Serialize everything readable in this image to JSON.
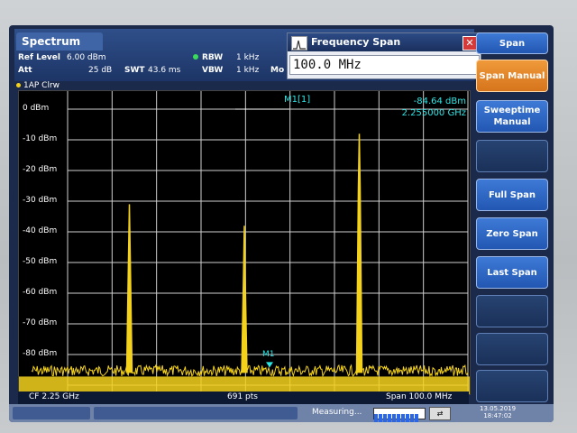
{
  "app": {
    "title": "Spectrum"
  },
  "header": {
    "ref_level_label": "Ref Level",
    "ref_level_value": "6.00 dBm",
    "att_label": "Att",
    "att_value": "25 dB",
    "swt_label": "SWT",
    "swt_value": "43.6 ms",
    "rbw_label": "RBW",
    "rbw_value": "1 kHz",
    "vbw_label": "VBW",
    "vbw_value": "1 kHz",
    "mode_partial": "Mo"
  },
  "dialog": {
    "title": "Frequency Span",
    "value": "100.0 MHz"
  },
  "trace": {
    "label": "1AP Clrw"
  },
  "plot": {
    "y_labels": [
      "0 dBm",
      "-10 dBm",
      "-20 dBm",
      "-30 dBm",
      "-40 dBm",
      "-50 dBm",
      "-60 dBm",
      "-70 dBm",
      "-80 dBm"
    ],
    "marker_name": "M1[1]",
    "marker_level": "-84.64 dBm",
    "marker_freq": "2.255000 GHz",
    "marker_tag": "M1"
  },
  "chart_data": {
    "type": "line",
    "title": "",
    "xlabel": "",
    "ylabel": "",
    "ylim": [
      -100,
      10
    ],
    "x_center_ghz": 2.25,
    "x_span_mhz": 100.0,
    "noise_floor_dbm": -86,
    "peaks": [
      {
        "x_frac": 0.245,
        "y": -31
      },
      {
        "x_frac": 0.5,
        "y": -38
      },
      {
        "x_frac": 0.755,
        "y": -8
      }
    ],
    "grid": true
  },
  "footer": {
    "cf": "CF 2.25 GHz",
    "pts": "691 pts",
    "span": "Span 100.0 MHz"
  },
  "status": {
    "measuring": "Measuring...",
    "date": "13.05.2019",
    "time": "18:47:02"
  },
  "softkeys": [
    {
      "label": "Span",
      "style": "blue"
    },
    {
      "label": "Span Manual",
      "style": "orange"
    },
    {
      "label": "Sweeptime Manual",
      "style": "blue"
    },
    {
      "label": "",
      "style": "dark"
    },
    {
      "label": "Full Span",
      "style": "blue"
    },
    {
      "label": "Zero Span",
      "style": "blue"
    },
    {
      "label": "Last Span",
      "style": "blue"
    },
    {
      "label": "",
      "style": "dark"
    },
    {
      "label": "",
      "style": "dark"
    },
    {
      "label": "",
      "style": "dark"
    }
  ],
  "colors": {
    "trace": "#f4d21c",
    "marker": "#2fe6e6",
    "grid": "#cfcfcf"
  }
}
